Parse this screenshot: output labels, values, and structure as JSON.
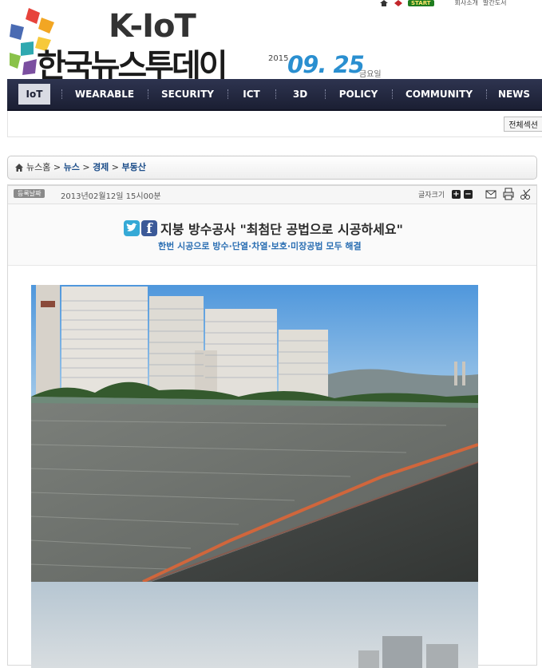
{
  "top_util": {
    "start_label": "START",
    "link1": "회사소개",
    "link2": "발간도서"
  },
  "logo": {
    "brand": "K-IoT",
    "title": "한국뉴스투데이"
  },
  "date": {
    "year": "2015",
    "month_day": "09. 25",
    "weekday": "금요일"
  },
  "nav": [
    "IoT",
    "WEARABLE",
    "SECURITY",
    "ICT",
    "3D",
    "POLICY",
    "COMMUNITY",
    "NEWS"
  ],
  "sub_bar": {
    "all_section": "전체섹션"
  },
  "breadcrumb": {
    "home": "뉴스홈",
    "sep1": " > ",
    "level1": "뉴스",
    "sep2": " > ",
    "level2": "경제",
    "sep3": " > ",
    "level3": "부동산"
  },
  "article": {
    "label": "등록날짜",
    "date": "2013년02월12일 15시00분",
    "font_size_label": "글자크기",
    "plus": "+",
    "minus": "−",
    "headline": "지붕 방수공사 \"최첨단 공법으로 시공하세요\"",
    "subheadline": "한번 시공으로 방수·단열·차열·보호·미장공법 모두 해결"
  },
  "colors": {
    "nav_bg": "#1b1f33",
    "date_blue": "#2a8fd0",
    "sub_blue": "#2b6fb3",
    "logo_teal": "#1f9aa0"
  }
}
